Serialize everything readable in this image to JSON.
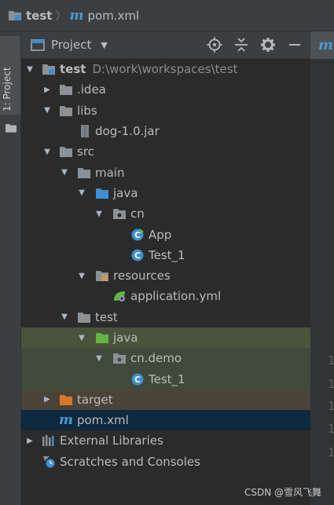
{
  "navbar": {
    "crumbs": [
      {
        "label": "test",
        "icon": "folder-icon"
      },
      {
        "label": "pom.xml",
        "icon": "maven-icon"
      }
    ],
    "separator": "〉"
  },
  "toolstrip": {
    "project_tab_label": "1: Project"
  },
  "panel": {
    "title": "Project",
    "tools": [
      "locate-icon",
      "collapse-all-icon",
      "gear-icon",
      "hide-icon"
    ]
  },
  "editor": {
    "tab_icon": "maven-icon",
    "line_numbers": [
      "1",
      "1",
      "1",
      "1",
      "1"
    ]
  },
  "tree": {
    "root": {
      "label": "test",
      "path": "D:\\work\\workspaces\\test"
    },
    "idea": "idea",
    "idea_label": ".idea",
    "libs": "libs",
    "dog_jar": "dog-1.0.jar",
    "src": "src",
    "main": "main",
    "main_java": "java",
    "cn": "cn",
    "app": "App",
    "test1_main": "Test_1",
    "resources": "resources",
    "application_yml": "application.yml",
    "test_dir": "test",
    "test_java": "java",
    "cn_demo": "cn.demo",
    "test1_test": "Test_1",
    "target": "target",
    "pom": "pom.xml",
    "external_libraries": "External Libraries",
    "scratches": "Scratches and Consoles"
  },
  "colors": {
    "background": "#2b2b2b",
    "panel": "#3c3f41",
    "selection": "#0d293e",
    "test_highlight": "#49543b",
    "excluded_highlight": "#4a4438",
    "folder_gray": "#8c9196",
    "folder_blue": "#3d8fd1",
    "folder_green": "#62b543",
    "folder_orange": "#d9762b",
    "maven_blue": "#4a9ad8"
  },
  "watermark": "CSDN @雪风飞舞"
}
